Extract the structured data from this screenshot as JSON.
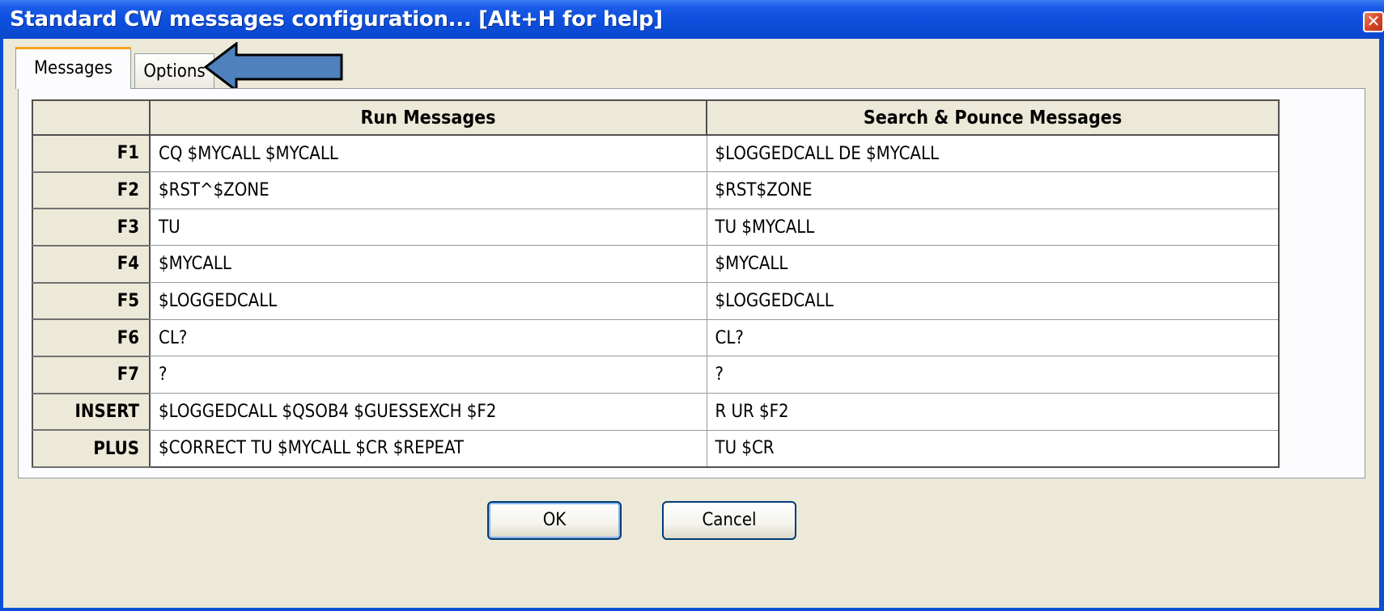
{
  "window": {
    "title": "Standard CW messages configuration... [Alt+H for help]",
    "close_glyph": "✕"
  },
  "tabs": [
    {
      "label": "Messages",
      "active": true
    },
    {
      "label": "Options",
      "active": false
    }
  ],
  "table": {
    "headers": [
      "",
      "Run Messages",
      "Search & Pounce Messages"
    ],
    "rows": [
      {
        "key": "F1",
        "run": "CQ $MYCALL $MYCALL",
        "sp": "$LOGGEDCALL DE $MYCALL"
      },
      {
        "key": "F2",
        "run": "$RST^$ZONE",
        "sp": "$RST$ZONE"
      },
      {
        "key": "F3",
        "run": "TU",
        "sp": "TU $MYCALL"
      },
      {
        "key": "F4",
        "run": "$MYCALL",
        "sp": "$MYCALL"
      },
      {
        "key": "F5",
        "run": "$LOGGEDCALL",
        "sp": "$LOGGEDCALL"
      },
      {
        "key": "F6",
        "run": "CL?",
        "sp": "CL?"
      },
      {
        "key": "F7",
        "run": "?",
        "sp": "?"
      },
      {
        "key": "INSERT",
        "run": "$LOGGEDCALL $QSOB4 $GUESSEXCH $F2",
        "sp": "R UR $F2"
      },
      {
        "key": "PLUS",
        "run": "$CORRECT TU $MYCALL $CR $REPEAT",
        "sp": "TU $CR"
      }
    ]
  },
  "buttons": {
    "ok_label": "OK",
    "cancel_label": "Cancel"
  },
  "colors": {
    "titlebar": "#0a4fd6",
    "dialog_bg": "#ece9d8",
    "arrow_fill": "#4f81bd",
    "arrow_stroke": "#000000"
  },
  "annotation": {
    "icon": "left-arrow-icon",
    "points_to": "Options tab"
  }
}
